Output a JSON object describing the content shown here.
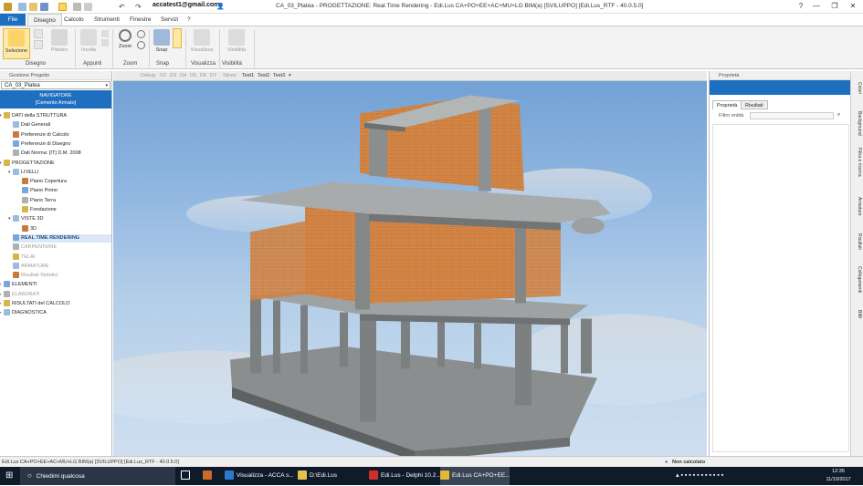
{
  "window": {
    "title": "CA_03_Platea  -  PROGETTAZIONE: Real Time Rendering - Edi.Lus CA+PO+EE+AC+MU+LG BIM(a) [SVILUPPO] [Edi.Lus_RTF - 40.0.5.0]",
    "user_email": "accatest1@gmail.com",
    "controls": [
      "?",
      "—",
      "❐",
      "✕"
    ]
  },
  "ribbon_tabs": [
    "File",
    "Disegno",
    "Calcolo",
    "Strumenti",
    "Finestre",
    "Servizi",
    "?"
  ],
  "active_tab": "Disegno",
  "ribbon": {
    "buttons": {
      "selezione": "Selezione",
      "pilastro": "Pilastro",
      "incolla": "Incolla",
      "zoom": "Zoom",
      "snap": "Snap",
      "visualizza": "Visualizza",
      "visibilita": "Visibilità"
    },
    "groups": [
      "Disegno",
      "Appunti",
      "Zoom",
      "Snap",
      "Visualizza",
      "Visibilità"
    ]
  },
  "left_panel": {
    "header": "Gestione Progetto",
    "project_combo": "CA_03_Platea",
    "navigator_title": "NAVIGATORE",
    "navigator_subtitle": "[Cemento Armato]",
    "tree": [
      {
        "label": "DATI della STRUTTURA",
        "level": 0,
        "expanded": true,
        "dim": false
      },
      {
        "label": "Dati Generali",
        "level": 1,
        "dim": false
      },
      {
        "label": "Preferenze di Calcolo",
        "level": 1,
        "dim": false
      },
      {
        "label": "Preferenze di Disegno",
        "level": 1,
        "dim": false
      },
      {
        "label": "Dati Norma: [IT] D.M. 2008",
        "level": 1,
        "dim": false
      },
      {
        "label": "PROGETTAZIONE",
        "level": 0,
        "expanded": true,
        "dim": false
      },
      {
        "label": "LIVELLI",
        "level": 1,
        "expanded": true,
        "dim": false
      },
      {
        "label": "Piano Copertura",
        "level": 2,
        "dim": false
      },
      {
        "label": "Piano Primo",
        "level": 2,
        "dim": false
      },
      {
        "label": "Piano Terra",
        "level": 2,
        "dim": false
      },
      {
        "label": "Fondazione",
        "level": 2,
        "dim": false
      },
      {
        "label": "VISTE 3D",
        "level": 1,
        "expanded": true,
        "dim": false
      },
      {
        "label": "3D",
        "level": 2,
        "dim": false
      },
      {
        "label": "REAL TIME RENDERING",
        "level": 1,
        "selected": true,
        "dim": false
      },
      {
        "label": "CARPENTERIE",
        "level": 1,
        "dim": true
      },
      {
        "label": "TELAI",
        "level": 1,
        "dim": true
      },
      {
        "label": "ARMATURE",
        "level": 1,
        "dim": true
      },
      {
        "label": "Risultati Sintetici",
        "level": 1,
        "dim": true
      },
      {
        "label": "ELEMENTI",
        "level": 0,
        "dim": false
      },
      {
        "label": "ELABORATI",
        "level": 0,
        "dim": true
      },
      {
        "label": "RISULTATI del CALCOLO",
        "level": 0,
        "dim": false
      },
      {
        "label": "DIAGNOSTICA",
        "level": 0,
        "dim": false
      }
    ]
  },
  "viewport": {
    "toolbar": [
      "Debug",
      "D2",
      "D3",
      "D4",
      "D5",
      "D6",
      "D7",
      "Slices",
      "Test1",
      "Test2",
      "Test3"
    ]
  },
  "right_panel": {
    "header": "Proprietà",
    "tabs": [
      "Proprietà",
      "Risultati"
    ],
    "filter_label": "Filtro entità"
  },
  "side_tabs": [
    "Colori",
    "Background",
    "Filtra e ricerca",
    "Armature",
    "Risultati",
    "Collegamenti",
    "BIM"
  ],
  "status": {
    "left": "Edi.Lus CA+PO+EE+AC+MU+LG BIM(a) [SVILUPPO] [Edi.Lus_RTF - 40.0.5.0]",
    "right": "Non calcolato"
  },
  "taskbar": {
    "search": "Chiedimi qualcosa",
    "apps": [
      "Visualizza - ACCA s...",
      "D:\\Edi.Lus",
      "Edi.Lus - Delphi 10.2...",
      "Edi.Lus CA+PO+EE..."
    ],
    "time": "12:35",
    "date": "11/10/2017"
  },
  "colors": {
    "accent": "#1f6fc0",
    "taskbar": "#101b2a",
    "brick": "#d98b4a",
    "concrete": "#8e9090"
  }
}
